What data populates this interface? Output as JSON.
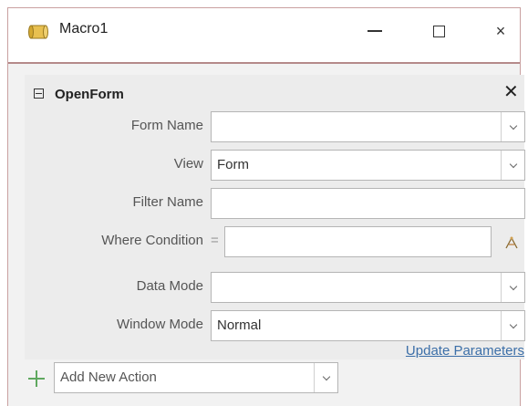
{
  "window": {
    "title": "Macro1",
    "controls": {
      "minimize": "minimize",
      "maximize": "maximize",
      "close": "×"
    }
  },
  "action": {
    "name": "OpenForm",
    "arguments": [
      {
        "label": "Form Name",
        "value": "",
        "type": "dropdown"
      },
      {
        "label": "View",
        "value": "Form",
        "type": "dropdown"
      },
      {
        "label": "Filter Name",
        "value": "",
        "type": "text"
      },
      {
        "label": "Where Condition",
        "value": "",
        "prefix": "=",
        "type": "expression"
      },
      {
        "label": "Data Mode",
        "value": "",
        "type": "dropdown"
      },
      {
        "label": "Window Mode",
        "value": "Normal",
        "type": "dropdown"
      }
    ],
    "update_link": "Update Parameters"
  },
  "add_action": {
    "placeholder": "Add New Action"
  },
  "colors": {
    "accent_link": "#3c6fa8",
    "plus_green": "#5fa85f",
    "title_border": "#b58a8a"
  },
  "icons": {
    "app": "macro-scroll-icon",
    "collapse": "collapse-minus-icon",
    "delete": "delete-x-icon",
    "builder": "expression-builder-icon",
    "add": "plus-icon"
  }
}
